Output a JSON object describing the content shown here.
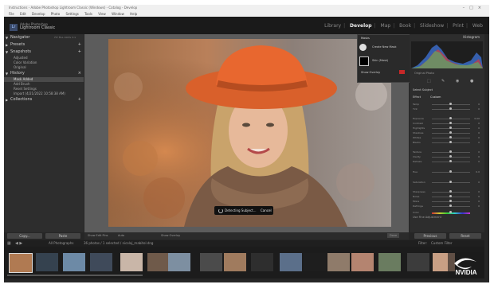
{
  "window": {
    "title": "Instructions - Adobe Photoshop Lightroom Classic (Windows) - Catalog - Develop",
    "menu": [
      "File",
      "Edit",
      "Develop",
      "Photo",
      "Settings",
      "Tools",
      "View",
      "Window",
      "Help"
    ]
  },
  "app": {
    "badge": "Lr",
    "brand_line1": "Adobe Photoshop",
    "brand_line2": "Lightroom Classic",
    "modules": [
      "Library",
      "Develop",
      "Map",
      "Book",
      "Slideshow",
      "Print",
      "Web"
    ],
    "active_module": "Develop"
  },
  "left_panel": {
    "sections": [
      {
        "label": "Navigator",
        "options": "FIT   FILL   100%   3:1"
      },
      {
        "label": "Presets"
      },
      {
        "label": "Snapshots",
        "items": [
          "Adjusted",
          "Color Variation",
          "Original"
        ]
      },
      {
        "label": "History",
        "items": [
          "Mask Added",
          "Add Brush",
          "Reset Settings",
          "Import (4/21/2022 10:58:38 AM)"
        ]
      },
      {
        "label": "Collections"
      }
    ],
    "copy_label": "Copy...",
    "paste_label": "Paste"
  },
  "mask_panel": {
    "title": "Masks",
    "create_label": "Create New Mask",
    "mask_name": "Mask 1",
    "item_label": "Skin (Mask)",
    "overlay_label": "Show Overlay"
  },
  "detect": {
    "label": "Detecting Subject...",
    "cancel": "Cancel"
  },
  "toolbar": {
    "overlay": "Show Edit Pins",
    "auto": "Auto",
    "overlay_mode": "Show Overlay",
    "done": "Done",
    "close": "Close"
  },
  "right_panel": {
    "histogram_title": "Histogram",
    "original_photo": "Original Photo",
    "mask_name": "Select Subject",
    "effect_label": "Effect",
    "preset": "Custom",
    "sliders": [
      {
        "label": "Temp",
        "value": "0"
      },
      {
        "label": "Tint",
        "value": "0"
      },
      {
        "label": "Exposure",
        "value": "0.00"
      },
      {
        "label": "Contrast",
        "value": "0"
      },
      {
        "label": "Highlights",
        "value": "0"
      },
      {
        "label": "Shadows",
        "value": "0"
      },
      {
        "label": "Whites",
        "value": "0"
      },
      {
        "label": "Blacks",
        "value": "0"
      },
      {
        "label": "Texture",
        "value": "0"
      },
      {
        "label": "Clarity",
        "value": "0"
      },
      {
        "label": "Dehaze",
        "value": "0"
      },
      {
        "label": "Hue",
        "value": "0.0"
      },
      {
        "label": "Saturation",
        "value": "0"
      },
      {
        "label": "Sharpness",
        "value": "0"
      },
      {
        "label": "Noise",
        "value": "0"
      },
      {
        "label": "Moire",
        "value": "0"
      },
      {
        "label": "Defringe",
        "value": "0"
      },
      {
        "label": "Color",
        "value": ""
      }
    ],
    "use_fine_adjustment": "Use Fine Adjustment",
    "previous_label": "Previous",
    "reset_label": "Reset"
  },
  "filmstrip": {
    "path": "All Photographs",
    "info": "36 photos / 1 selected / nicolaj_mabitol.dng",
    "filter_label": "Filter:",
    "filter_value": "Custom Filter"
  },
  "watermark": {
    "text": "NVIDIA"
  },
  "colors": {
    "accent": "#76b900",
    "orange_hat": "#e8612a"
  }
}
